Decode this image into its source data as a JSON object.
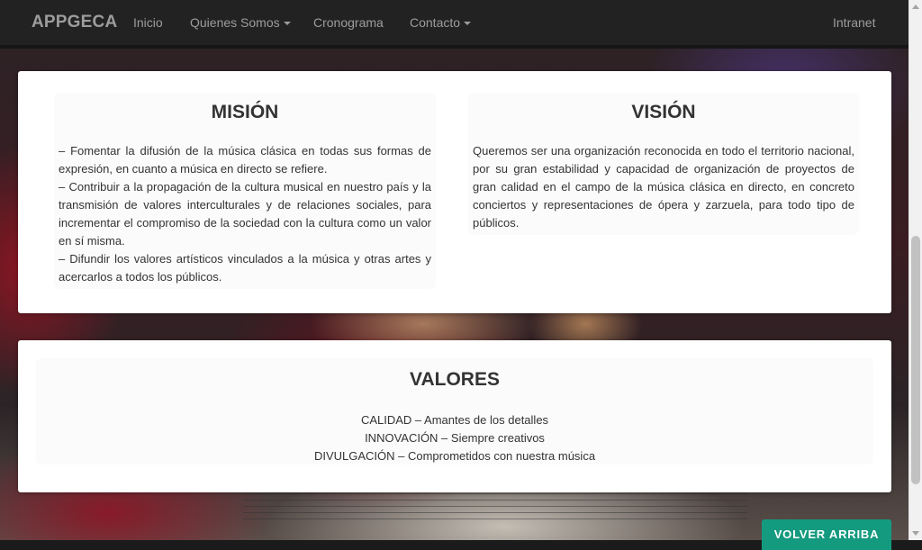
{
  "navbar": {
    "brand": "APPGECA",
    "items": [
      {
        "label": "Inicio",
        "dropdown": false
      },
      {
        "label": "Quienes Somos",
        "dropdown": true
      },
      {
        "label": "Cronograma",
        "dropdown": false
      },
      {
        "label": "Contacto",
        "dropdown": true
      }
    ],
    "right_link": "Intranet"
  },
  "mision": {
    "title": "MISIÓN",
    "lines": [
      "– Fomentar la difusión de la música clásica en todas sus formas de expresión, en cuanto a música en directo se refiere.",
      "– Contribuir a la propagación de la cultura musical en nuestro país y la transmisión de valores interculturales y de relaciones sociales, para incrementar el compromiso de la sociedad con la cultura como un valor en sí misma.",
      "– Difundir los valores artísticos vinculados a la música y otras artes y acercarlos a todos los públicos."
    ]
  },
  "vision": {
    "title": "VISIÓN",
    "text": "Queremos ser una organización reconocida en todo el territorio nacional, por su gran estabilidad y capacidad de organización de proyectos de gran calidad en el campo de la música clásica en directo, en concreto conciertos y representaciones de ópera y zarzuela, para todo tipo de públicos."
  },
  "valores": {
    "title": "VALORES",
    "lines": [
      "CALIDAD – Amantes de los detalles",
      "INNOVACIÓN – Siempre creativos",
      "DIVULGACIÓN – Comprometidos con nuestra música"
    ]
  },
  "back_to_top": "VOLVER ARRIBA",
  "colors": {
    "navbar_bg": "#222222",
    "nav_text": "#9d9d9d",
    "button_bg": "#149a7f"
  }
}
